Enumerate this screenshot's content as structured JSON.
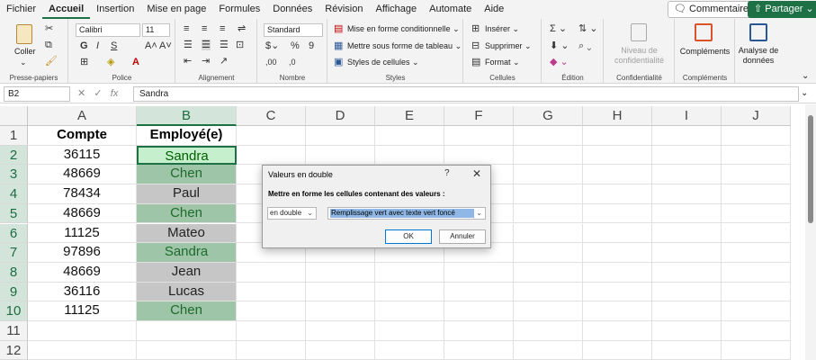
{
  "menu": {
    "tabs": [
      "Fichier",
      "Accueil",
      "Insertion",
      "Mise en page",
      "Formules",
      "Données",
      "Révision",
      "Affichage",
      "Automate",
      "Aide"
    ],
    "active_tab": "Accueil",
    "comments_label": "Commentaires",
    "share_label": "Partager"
  },
  "ribbon": {
    "clipboard": {
      "paste_label": "Coller",
      "group_label": "Presse-papiers"
    },
    "font": {
      "font_name": "Calibri",
      "font_size": "11",
      "group_label": "Police"
    },
    "alignment": {
      "group_label": "Alignement"
    },
    "number": {
      "format": "Standard",
      "group_label": "Nombre"
    },
    "styles": {
      "conditional_label": "Mise en forme conditionnelle",
      "table_label": "Mettre sous forme de tableau",
      "cell_styles_label": "Styles de cellules",
      "group_label": "Styles"
    },
    "cells": {
      "insert_label": "Insérer",
      "delete_label": "Supprimer",
      "format_label": "Format",
      "group_label": "Cellules"
    },
    "editing": {
      "group_label": "Édition"
    },
    "sensitivity": {
      "line1": "Niveau de",
      "line2": "confidentialité",
      "group_label": "Confidentialité"
    },
    "addins": {
      "button_label": "Compléments",
      "group_label": "Compléments"
    },
    "analyze": {
      "line1": "Analyse de",
      "line2": "données"
    }
  },
  "formula_bar": {
    "name_box": "B2",
    "value": "Sandra"
  },
  "grid": {
    "columns": [
      "A",
      "B",
      "C",
      "D",
      "E",
      "F",
      "G",
      "H",
      "I",
      "J"
    ],
    "rows": [
      "1",
      "2",
      "3",
      "4",
      "5",
      "6",
      "7",
      "8",
      "9",
      "10",
      "11",
      "12"
    ],
    "header_a": "Compte",
    "header_b": "Employé(e)",
    "data": [
      {
        "compte": "36115",
        "employe": "Sandra",
        "dup": true
      },
      {
        "compte": "48669",
        "employe": "Chen",
        "dup": true
      },
      {
        "compte": "78434",
        "employe": "Paul",
        "dup": false
      },
      {
        "compte": "48669",
        "employe": "Chen",
        "dup": true
      },
      {
        "compte": "11125",
        "employe": "Mateo",
        "dup": false
      },
      {
        "compte": "97896",
        "employe": "Sandra",
        "dup": true
      },
      {
        "compte": "48669",
        "employe": "Jean",
        "dup": false
      },
      {
        "compte": "36116",
        "employe": "Lucas",
        "dup": false
      },
      {
        "compte": "11125",
        "employe": "Chen",
        "dup": true
      }
    ]
  },
  "dialog": {
    "title": "Valeurs en double",
    "help": "?",
    "close": "✕",
    "prompt": "Mettre en forme les cellules contenant des valeurs :",
    "type_value": "en double",
    "format_value": "Remplissage vert avec texte vert foncé",
    "ok_label": "OK",
    "cancel_label": "Annuler"
  }
}
